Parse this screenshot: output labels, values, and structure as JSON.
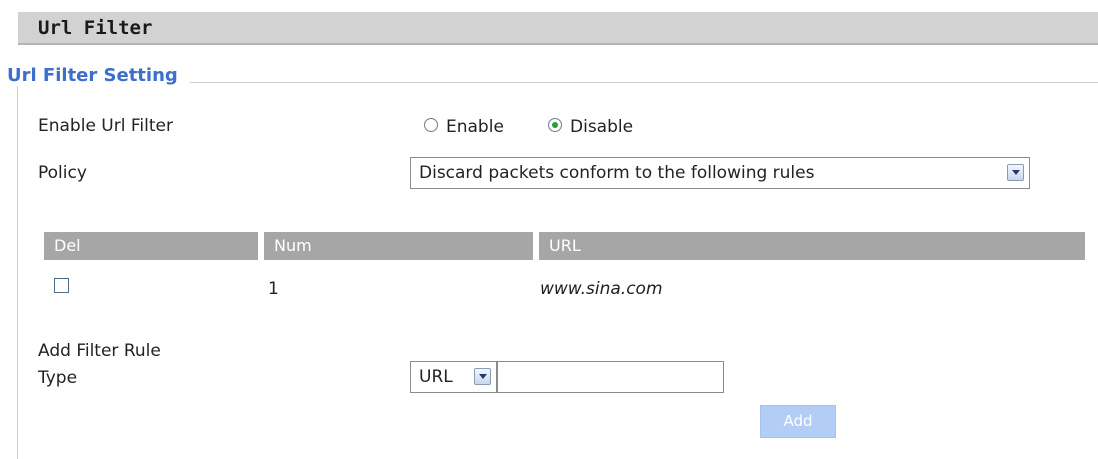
{
  "header": {
    "title": "Url Filter"
  },
  "section": {
    "title": "Url Filter Setting"
  },
  "enable_filter": {
    "label": "Enable Url Filter",
    "option_enable": "Enable",
    "option_disable": "Disable",
    "selected": "Disable"
  },
  "policy": {
    "label": "Policy",
    "value": "Discard packets conform to the following rules"
  },
  "table": {
    "headers": [
      "Del",
      "Num",
      "URL"
    ],
    "rows": [
      {
        "del_checked": false,
        "num": "1",
        "url": "www.sina.com"
      }
    ]
  },
  "add_rule": {
    "heading": "Add Filter Rule",
    "type_label": "Type",
    "type_value": "URL",
    "value": "",
    "add_button": "Add"
  },
  "colors": {
    "header_bg": "#d2d2d2",
    "section_title": "#3b6fc9",
    "table_header_bg": "#a6a6a6",
    "add_button_bg": "#b3cef6",
    "radio_selected": "#27a039"
  }
}
